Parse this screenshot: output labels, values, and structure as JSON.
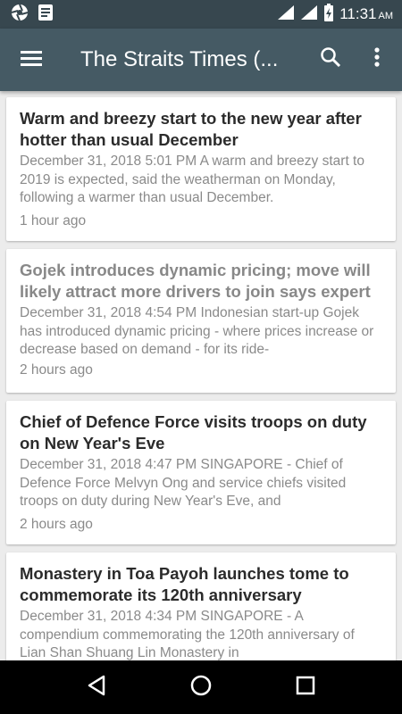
{
  "status_bar": {
    "time": "11:31",
    "ampm": "AM"
  },
  "app_bar": {
    "title": "The Straits Times (..."
  },
  "articles": [
    {
      "title": "Warm and breezy start to the new year after hotter than usual December",
      "snippet": "December 31, 2018 5:01 PM A warm and breezy start to 2019 is expected, said the weatherman on Monday, following a warmer than usual December.",
      "time_ago": "1 hour ago",
      "read": false
    },
    {
      "title": "Gojek introduces dynamic pricing; move will likely attract more drivers to join says expert",
      "snippet": "December 31, 2018 4:54 PM Indonesian start-up Gojek has introduced dynamic pricing - where prices increase or decrease based on demand - for its ride-",
      "time_ago": "2 hours ago",
      "read": true
    },
    {
      "title": "Chief of Defence Force visits troops on duty on New Year's Eve",
      "snippet": "December 31, 2018 4:47 PM SINGAPORE - Chief of Defence Force Melvyn Ong and service chiefs visited troops on duty during New Year's Eve, and",
      "time_ago": "2 hours ago",
      "read": false
    },
    {
      "title": "Monastery in Toa Payoh launches tome to commemorate its 120th anniversary",
      "snippet": "December 31, 2018 4:34 PM SINGAPORE - A compendium commemorating the 120th anniversary of Lian Shan Shuang Lin Monastery in",
      "time_ago": "",
      "read": false
    }
  ]
}
